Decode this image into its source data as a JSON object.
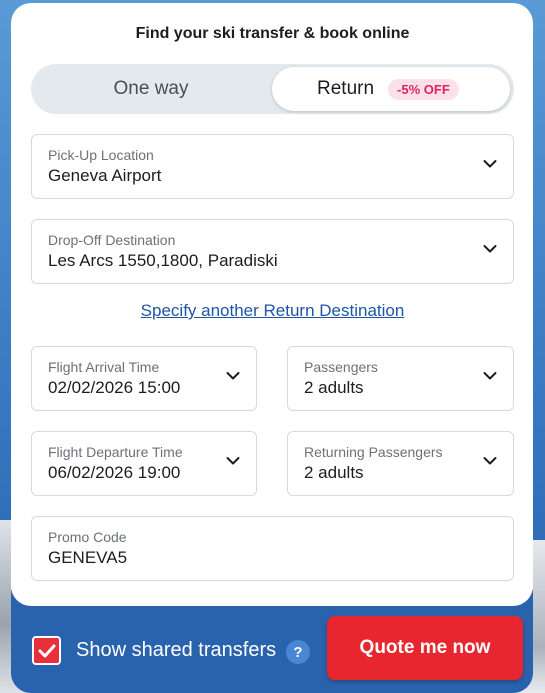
{
  "header": {
    "title": "Find your ski transfer & book online"
  },
  "trip_toggle": {
    "one_way_label": "One way",
    "return_label": "Return",
    "return_badge": "-5% OFF",
    "selected": "Return"
  },
  "pickup": {
    "label": "Pick-Up Location",
    "value": "Geneva Airport"
  },
  "dropoff": {
    "label": "Drop-Off Destination",
    "value": "Les Arcs 1550,1800, Paradiski"
  },
  "return_destination_link": "Specify another Return Destination",
  "flight_arrival": {
    "label": "Flight Arrival Time",
    "value": "02/02/2026 15:00"
  },
  "passengers": {
    "label": "Passengers",
    "value": "2 adults"
  },
  "flight_departure": {
    "label": "Flight Departure Time",
    "value": "06/02/2026 19:00"
  },
  "returning_passengers": {
    "label": "Returning Passengers",
    "value": "2 adults"
  },
  "promo": {
    "label": "Promo Code",
    "value": "GENEVA5"
  },
  "footer": {
    "shared_transfers_label": "Show shared transfers",
    "shared_transfers_checked": true,
    "help_glyph": "?",
    "quote_button": "Quote me now"
  },
  "colors": {
    "accent_red": "#e8262f",
    "badge_pink": "#e0245e",
    "link_blue": "#1d56a6",
    "footer_blue": "#2a63ad"
  },
  "icons": [
    "chevron-down-icon",
    "check-icon",
    "help-icon"
  ]
}
